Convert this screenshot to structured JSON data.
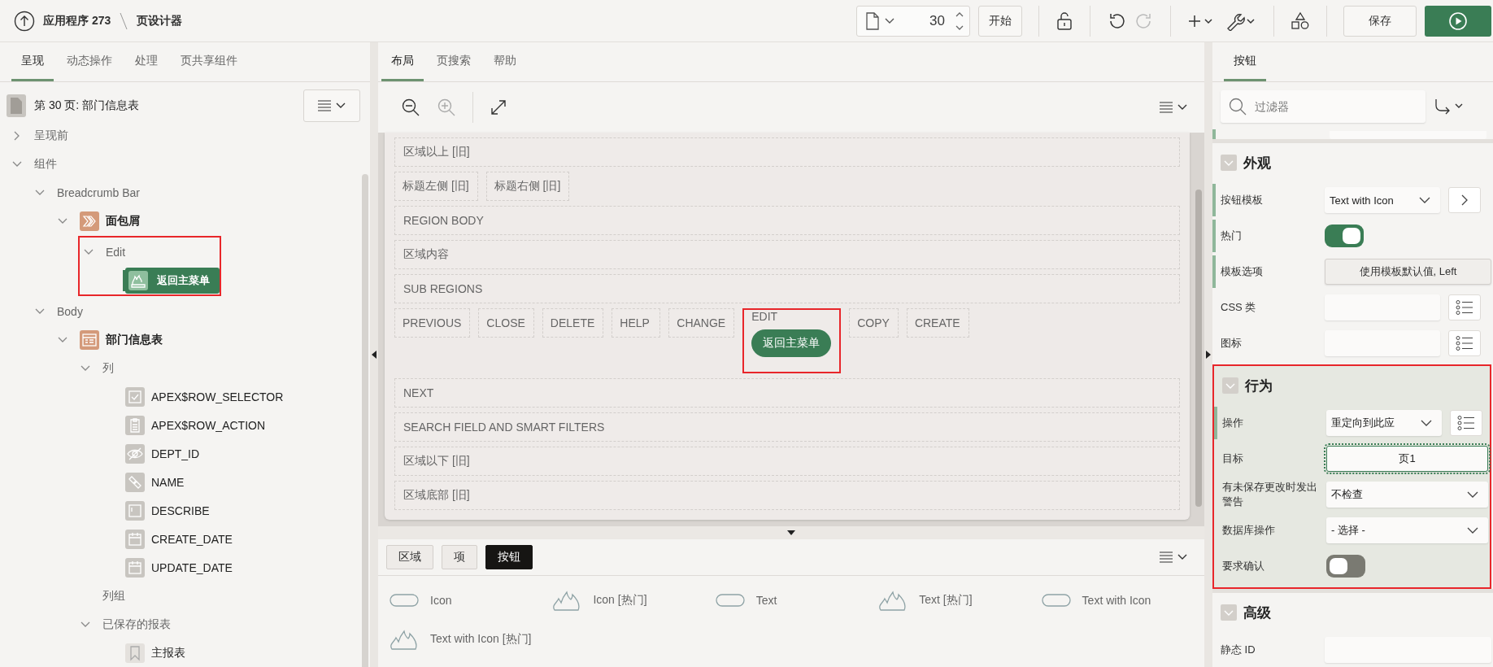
{
  "header": {
    "app_title": "应用程序 273",
    "page_title": "页设计器",
    "page_number": "30",
    "start_button": "开始",
    "save_button": "保存"
  },
  "left_panel": {
    "tabs": [
      {
        "label": "呈现",
        "selected": true
      },
      {
        "label": "动态操作",
        "selected": false
      },
      {
        "label": "处理",
        "selected": false
      },
      {
        "label": "页共享组件",
        "selected": false
      }
    ],
    "page_heading": "第 30 页: 部门信息表",
    "tree": [
      {
        "label": "呈现前",
        "kind": "folder",
        "expanded": false,
        "selected": false
      },
      {
        "label": "组件",
        "kind": "folder",
        "expanded": true,
        "selected": false,
        "children": [
          {
            "label": "Breadcrumb Bar",
            "kind": "folder",
            "expanded": true,
            "selected": false,
            "children": [
              {
                "label": "面包屑",
                "kind": "breadcrumb-region",
                "expanded": true,
                "selected": false,
                "children": [
                  {
                    "label": "Edit",
                    "kind": "folder",
                    "expanded": true,
                    "selected": false,
                    "highlighted": true,
                    "children": [
                      {
                        "label": "返回主菜单",
                        "kind": "button",
                        "selected": true
                      }
                    ]
                  }
                ]
              }
            ]
          },
          {
            "label": "Body",
            "kind": "folder",
            "expanded": true,
            "selected": false,
            "children": [
              {
                "label": "部门信息表",
                "kind": "report-region",
                "expanded": true,
                "selected": false,
                "children": [
                  {
                    "label": "列",
                    "kind": "folder",
                    "expanded": true,
                    "selected": false,
                    "children": [
                      {
                        "label": "APEX$ROW_SELECTOR",
                        "kind": "checkbox-column",
                        "selected": false
                      },
                      {
                        "label": "APEX$ROW_ACTION",
                        "kind": "action-column",
                        "selected": false
                      },
                      {
                        "label": "DEPT_ID",
                        "kind": "hidden-column",
                        "selected": false
                      },
                      {
                        "label": "NAME",
                        "kind": "link-column",
                        "selected": false
                      },
                      {
                        "label": "DESCRIBE",
                        "kind": "text-column",
                        "selected": false
                      },
                      {
                        "label": "CREATE_DATE",
                        "kind": "date-column",
                        "selected": false
                      },
                      {
                        "label": "UPDATE_DATE",
                        "kind": "date-column",
                        "selected": false
                      }
                    ]
                  },
                  {
                    "label": "列组",
                    "kind": "folder",
                    "selected": false
                  },
                  {
                    "label": "已保存的报表",
                    "kind": "folder",
                    "expanded": true,
                    "selected": false,
                    "children": [
                      {
                        "label": "主报表",
                        "kind": "saved-report",
                        "selected": false
                      }
                    ]
                  }
                ]
              }
            ]
          }
        ]
      }
    ]
  },
  "center_panel": {
    "tabs": [
      {
        "label": "布局",
        "selected": true
      },
      {
        "label": "页搜索",
        "selected": false
      },
      {
        "label": "帮助",
        "selected": false
      }
    ],
    "canvas_rows": [
      {
        "kind": "full",
        "slots": [
          {
            "label": "区域以上 [旧]",
            "highlighted": false
          }
        ]
      },
      {
        "kind": "inline",
        "slots": [
          {
            "label": "标题左侧 [旧]",
            "highlighted": false
          },
          {
            "label": "标题右侧 [旧]",
            "highlighted": false
          }
        ]
      },
      {
        "kind": "full",
        "slots": [
          {
            "label": "REGION BODY",
            "highlighted": false
          }
        ]
      },
      {
        "kind": "full",
        "slots": [
          {
            "label": "区域内容",
            "highlighted": false
          }
        ]
      },
      {
        "kind": "full",
        "slots": [
          {
            "label": "SUB REGIONS",
            "highlighted": false
          }
        ]
      },
      {
        "kind": "inline",
        "slots": [
          {
            "label": "PREVIOUS",
            "highlighted": false
          },
          {
            "label": "CLOSE",
            "highlighted": false
          },
          {
            "label": "DELETE",
            "highlighted": false
          },
          {
            "label": "HELP",
            "highlighted": false
          },
          {
            "label": "CHANGE",
            "highlighted": false
          },
          {
            "label": "EDIT",
            "button": "返回主菜单",
            "highlighted": true
          },
          {
            "label": "COPY",
            "highlighted": false
          },
          {
            "label": "CREATE",
            "highlighted": false
          }
        ]
      },
      {
        "kind": "full",
        "slots": [
          {
            "label": "NEXT",
            "highlighted": false
          }
        ]
      },
      {
        "kind": "full",
        "slots": [
          {
            "label": "SEARCH FIELD AND SMART FILTERS",
            "highlighted": false
          }
        ]
      },
      {
        "kind": "full",
        "slots": [
          {
            "label": "区域以下 [旧]",
            "highlighted": false
          }
        ]
      },
      {
        "kind": "full",
        "slots": [
          {
            "label": "区域底部 [旧]",
            "highlighted": false
          }
        ]
      }
    ],
    "gallery_tabs": [
      {
        "label": "区域",
        "selected": false
      },
      {
        "label": "项",
        "selected": false
      },
      {
        "label": "按钮",
        "selected": true
      }
    ],
    "gallery_items": [
      {
        "label": "Icon",
        "kind": "plain"
      },
      {
        "label": "Icon [热门]",
        "kind": "hot"
      },
      {
        "label": "Text",
        "kind": "plain"
      },
      {
        "label": "Text [热门]",
        "kind": "hot"
      },
      {
        "label": "Text with Icon",
        "kind": "plain"
      },
      {
        "label": "Text with Icon [热门]",
        "kind": "hot"
      }
    ]
  },
  "right_panel": {
    "tabs": [
      {
        "label": "按钮",
        "selected": true
      }
    ],
    "filter_placeholder": "过滤器",
    "sections": [
      {
        "title": "外观",
        "highlighted": false,
        "rows": [
          {
            "label": "按钮模板",
            "kind": "select",
            "value": "Text with Icon",
            "side_button": {
              "kind": "next"
            },
            "modified": true
          },
          {
            "label": "热门",
            "kind": "toggle",
            "on": true,
            "modified": true
          },
          {
            "label": "模板选项",
            "kind": "dialog",
            "value": "使用模板默认值, Left",
            "modified": true
          },
          {
            "label": "CSS 类",
            "kind": "text",
            "side_button": {
              "kind": "list"
            },
            "modified": false
          },
          {
            "label": "图标",
            "kind": "text",
            "side_button": {
              "kind": "list"
            },
            "modified": false
          }
        ]
      },
      {
        "title": "行为",
        "highlighted": true,
        "rows": [
          {
            "label": "操作",
            "kind": "select",
            "value": "重定向到此应",
            "side_button": {
              "kind": "list"
            },
            "modified": true
          },
          {
            "label": "目标",
            "kind": "link",
            "value": "页1",
            "modified": false
          },
          {
            "label": "有未保存更改时发出警告",
            "kind": "select",
            "value": "不检查",
            "modified": false
          },
          {
            "label": "数据库操作",
            "kind": "select",
            "value": "- 选择 -",
            "modified": false
          },
          {
            "label": "要求确认",
            "kind": "toggle",
            "on": false,
            "modified": false
          }
        ]
      },
      {
        "title": "高级",
        "highlighted": false,
        "rows": [
          {
            "label": "静态 ID",
            "kind": "text",
            "modified": false
          }
        ]
      }
    ]
  }
}
